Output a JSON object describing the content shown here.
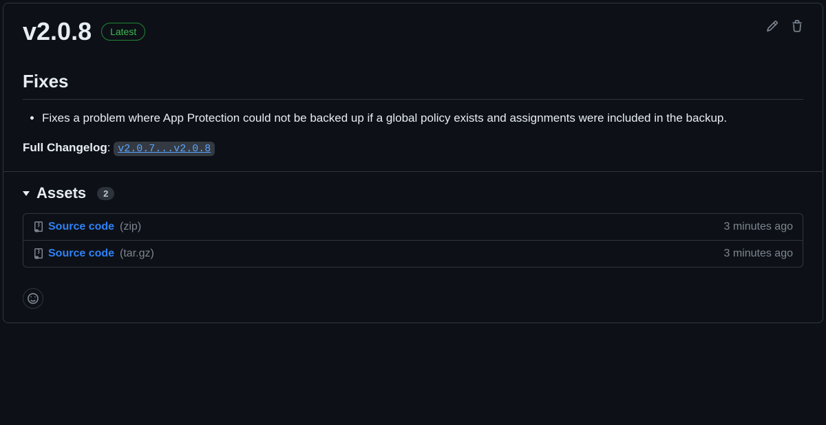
{
  "release": {
    "version": "v2.0.8",
    "badge": "Latest"
  },
  "body": {
    "fixes_heading": "Fixes",
    "fix_items": [
      "Fixes a problem where App Protection could not be backed up if a global policy exists and assignments were included in the backup."
    ],
    "changelog_label": "Full Changelog",
    "changelog_link": "v2.0.7...v2.0.8"
  },
  "assets": {
    "title": "Assets",
    "count": "2",
    "items": [
      {
        "name": "Source code",
        "ext": "(zip)",
        "time": "3 minutes ago"
      },
      {
        "name": "Source code",
        "ext": "(tar.gz)",
        "time": "3 minutes ago"
      }
    ]
  }
}
